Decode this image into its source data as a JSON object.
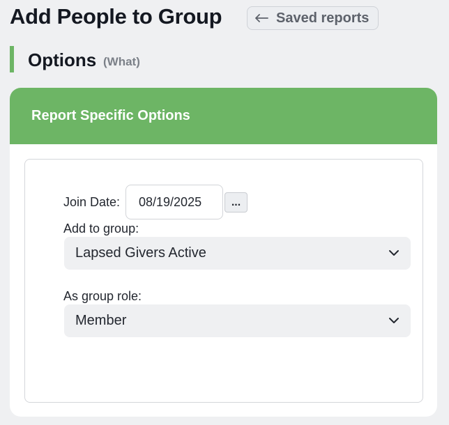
{
  "header": {
    "title": "Add People to Group",
    "back_label": "Saved reports"
  },
  "section": {
    "title": "Options",
    "subtitle": "(What)"
  },
  "card": {
    "title": "Report Specific Options",
    "join_date": {
      "label": "Join Date:",
      "value": "08/19/2025",
      "picker_label": "..."
    },
    "group": {
      "label": "Add to group:",
      "value": "Lapsed Givers Active"
    },
    "role": {
      "label": "As group role:",
      "value": "Member"
    }
  },
  "colors": {
    "accent": "#6db565",
    "page_bg": "#eff0f2",
    "select_bg": "#eff0f2"
  },
  "icons": {
    "back": "arrow-left-icon",
    "dropdown": "chevron-down-icon"
  }
}
